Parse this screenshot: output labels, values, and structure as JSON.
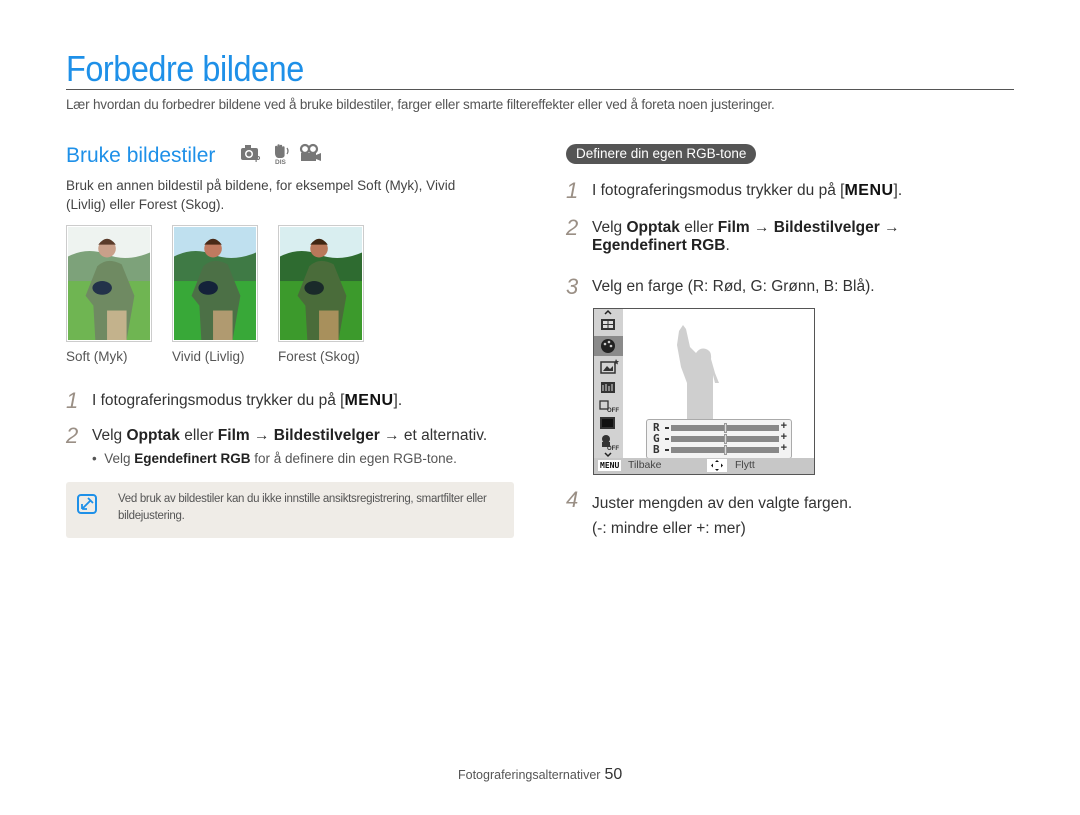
{
  "page": {
    "title": "Forbedre bildene",
    "intro": "Lær hvordan du forbedrer bildene ved å bruke bildestiler, farger eller smarte filtereffekter eller ved å foreta noen justeringer."
  },
  "left": {
    "section_title": "Bruke bildestiler",
    "mode_icons": [
      "camera-program-icon",
      "dual-is-icon",
      "movie-camera-icon"
    ],
    "description": "Bruk en annen bildestil på bildene, for eksempel Soft (Myk), Vivid (Livlig) eller Forest (Skog).",
    "thumbnails": [
      {
        "label": "Soft (Myk)"
      },
      {
        "label": "Vivid (Livlig)"
      },
      {
        "label": "Forest (Skog)"
      }
    ],
    "steps": [
      {
        "num": "1",
        "pre": "I fotograferingsmodus trykker du på [",
        "key": "MENU",
        "post": "]."
      },
      {
        "num": "2",
        "pre": "Velg ",
        "b1": "Opptak",
        "mid1": " eller ",
        "b2": "Film",
        "mid2": " → ",
        "b3": "Bildestilvelger",
        "post": " → et alternativ."
      }
    ],
    "bullet": {
      "pre": "Velg ",
      "bold": "Egendefinert RGB",
      "post": " for å definere din egen RGB-tone."
    },
    "note": "Ved bruk av bildestiler kan du ikke innstille ansiktsregistrering, smartfilter eller bildejustering."
  },
  "right": {
    "pill": "Definere din egen RGB-tone",
    "steps": [
      {
        "num": "1",
        "pre": "I fotograferingsmodus trykker du på [",
        "key": "MENU",
        "post": "]."
      },
      {
        "num": "2",
        "pre": "Velg ",
        "b1": "Opptak",
        "mid1": " eller ",
        "b2": "Film",
        "mid2": " → ",
        "b3": "Bildestilvelger",
        "post": " →",
        "line2": "Egendefinert RGB",
        "line2_post": "."
      },
      {
        "num": "3",
        "text": "Velg en farge (R: Rød, G: Grønn, B: Blå)."
      },
      {
        "num": "4",
        "text": "Juster mengden av den valgte fargen.",
        "line2": "(-: mindre eller +: mer)"
      }
    ],
    "camera_screen": {
      "channels": [
        {
          "label": "R",
          "value": 0.5
        },
        {
          "label": "G",
          "value": 0.5
        },
        {
          "label": "B",
          "value": 0.5
        }
      ],
      "back_key": "MENU",
      "back_label": "Tilbake",
      "move_label": "Flytt"
    }
  },
  "footer": {
    "section": "Fotograferingsalternativer",
    "page_number": "50"
  }
}
